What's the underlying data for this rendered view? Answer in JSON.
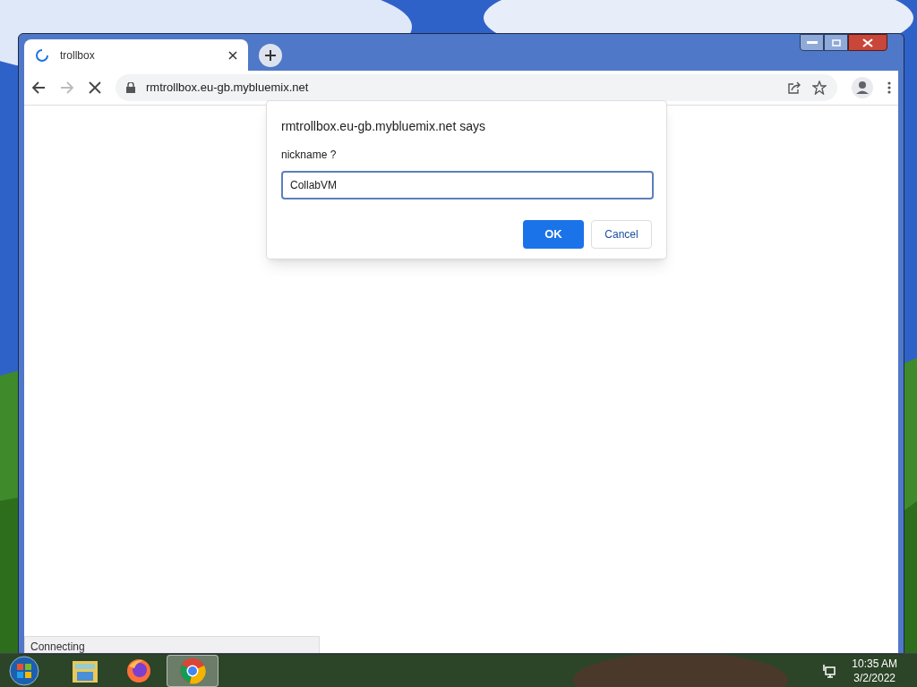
{
  "browser": {
    "tab": {
      "title": "trollbox",
      "loading": true
    },
    "address": "rmtrollbox.eu-gb.mybluemix.net",
    "status": "Connecting"
  },
  "dialog": {
    "title": "rmtrollbox.eu-gb.mybluemix.net says",
    "message": "nickname ?",
    "value": "CollabVM",
    "buttons": [
      {
        "label": "OK",
        "kind": "primary"
      },
      {
        "label": "Cancel",
        "kind": "secondary"
      }
    ]
  },
  "taskbar": {
    "apps": [
      {
        "kind": "folder",
        "active": false
      },
      {
        "kind": "firefox",
        "active": false
      },
      {
        "kind": "chrome",
        "active": true
      }
    ],
    "time": "10:35 AM",
    "date": "3/2/2022"
  }
}
